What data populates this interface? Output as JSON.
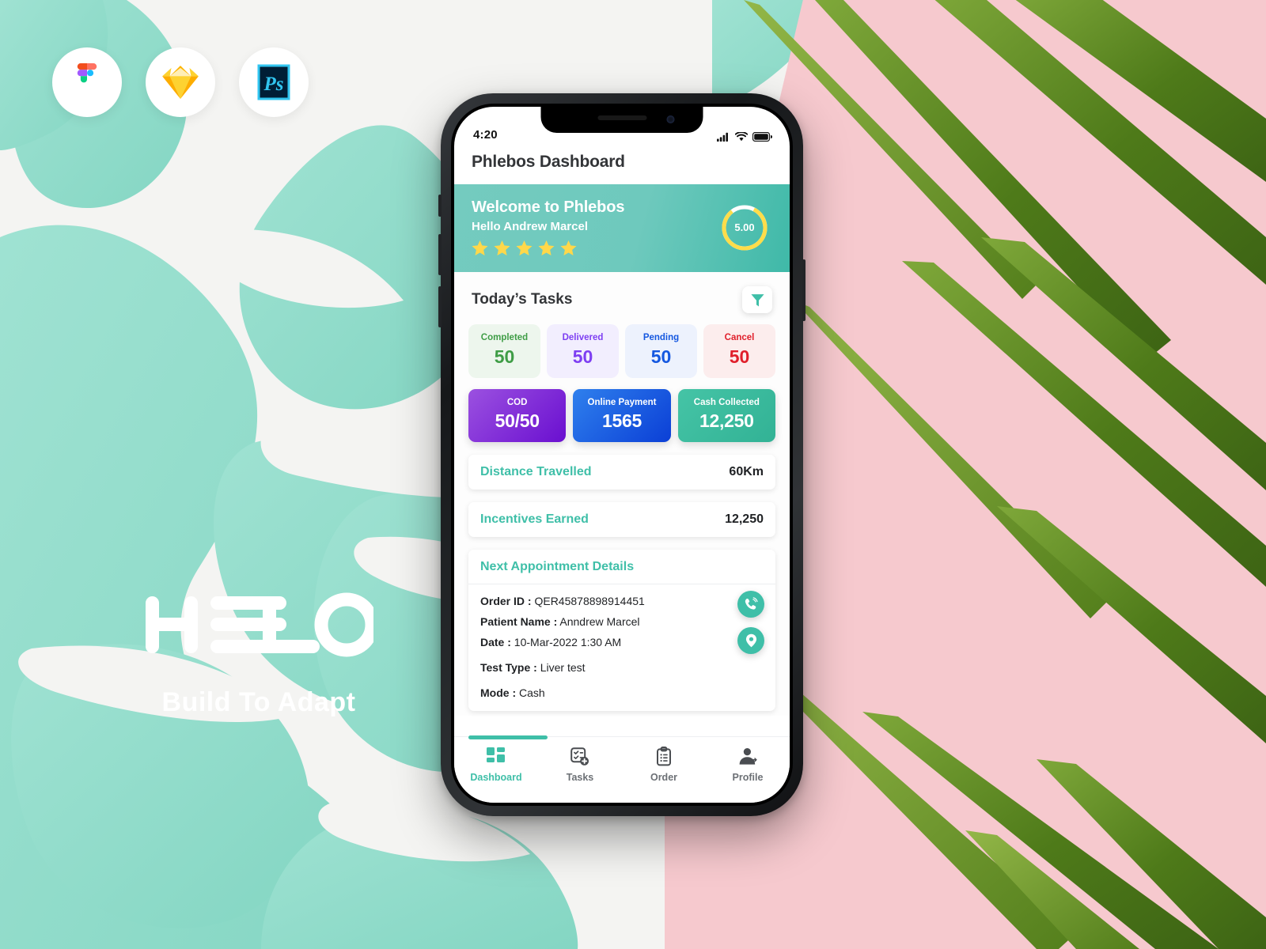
{
  "background": {
    "left_bg_color": "#f4f4f2",
    "mint_color": "#8fdccb",
    "pink_color": "#f6c9ce",
    "leaf_green": "#5d8f22"
  },
  "tool_chips": [
    {
      "name": "figma-icon",
      "label": "Figma"
    },
    {
      "name": "sketch-icon",
      "label": "Sketch"
    },
    {
      "name": "photoshop-icon",
      "label": "Ps"
    }
  ],
  "brand": {
    "name": "HELO",
    "tagline": "Build To Adapt"
  },
  "phone": {
    "status_bar": {
      "time": "4:20",
      "icons": [
        "cellular-signal-icon",
        "wifi-icon",
        "battery-icon"
      ]
    },
    "header": {
      "title": "Phlebos Dashboard"
    },
    "welcome": {
      "title": "Welcome to Phlebos",
      "subtitle": "Hello Andrew Marcel",
      "stars_filled": 5,
      "rating_value": "5.00",
      "ring_color": "#ffdd4a",
      "banner_color": "#6ec9bd"
    },
    "tasks": {
      "section_title": "Today’s Tasks",
      "filter_icon": "filter-funnel-icon",
      "stats": [
        {
          "label": "Completed",
          "value": "50",
          "color": "#3f9d46",
          "bg": "#edf6ed"
        },
        {
          "label": "Delivered",
          "value": "50",
          "color": "#7e3ff2",
          "bg": "#f2eefe"
        },
        {
          "label": "Pending",
          "value": "50",
          "color": "#1558e0",
          "bg": "#edf2fd"
        },
        {
          "label": "Cancel",
          "value": "50",
          "color": "#e01f2b",
          "bg": "#fceded"
        }
      ],
      "payments": [
        {
          "label": "COD",
          "value": "50/50",
          "grad_from": "#9b51e0",
          "grad_to": "#6a0fd0"
        },
        {
          "label": "Online Payment",
          "value": "1565",
          "grad_from": "#2f80ed",
          "grad_to": "#0b3fd6"
        },
        {
          "label": "Cash Collected",
          "value": "12,250",
          "grad_from": "#45c4a6",
          "grad_to": "#32b295"
        }
      ]
    },
    "metrics": [
      {
        "label": "Distance Travelled",
        "value": "60Km"
      },
      {
        "label": "Incentives Earned",
        "value": "12,250"
      }
    ],
    "appointment": {
      "title": "Next Appointment Details",
      "fields": [
        {
          "key": "Order ID :",
          "value": "QER45878898914451"
        },
        {
          "key": "Patient Name :",
          "value": "Anndrew Marcel"
        },
        {
          "key": "Date :",
          "value": "10-Mar-2022  1:30 AM"
        },
        {
          "key": "Test Type :",
          "value": "Liver test"
        },
        {
          "key": "Mode  :",
          "value": "Cash"
        }
      ],
      "actions": [
        {
          "name": "call-icon",
          "label": "Call"
        },
        {
          "name": "location-pin-icon",
          "label": "Location"
        }
      ]
    },
    "bottom_nav": {
      "active": "Dashboard",
      "items": [
        {
          "label": "Dashboard",
          "icon": "dashboard-grid-icon"
        },
        {
          "label": "Tasks",
          "icon": "task-checklist-add-icon"
        },
        {
          "label": "Order",
          "icon": "clipboard-list-icon"
        },
        {
          "label": "Profile",
          "icon": "user-profile-icon"
        }
      ]
    }
  }
}
